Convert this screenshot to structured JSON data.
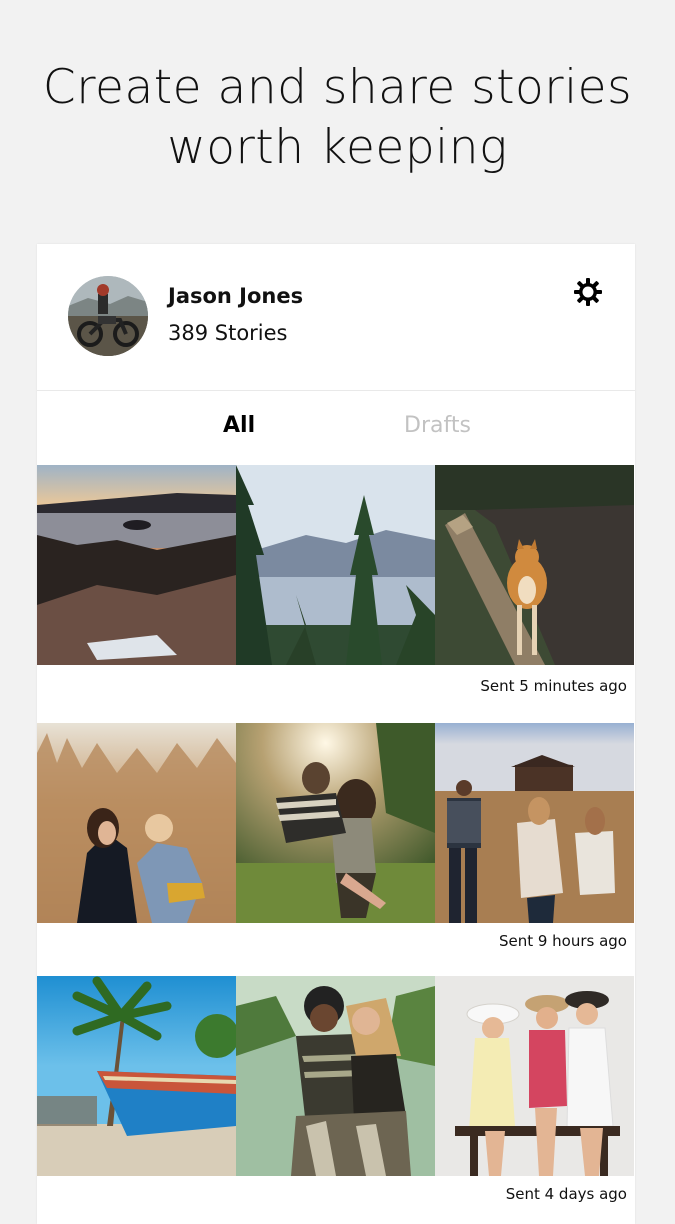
{
  "headline": {
    "line1": "Create and share stories",
    "line2": "worth keeping"
  },
  "profile": {
    "name": "Jason Jones",
    "stories": "389 Stories",
    "avatar": "avatar-motorcycle-photo",
    "settings_icon": "gear-icon"
  },
  "tabs": [
    {
      "label": "All",
      "selected": true
    },
    {
      "label": "Drafts",
      "selected": false
    }
  ],
  "stories": [
    {
      "sent": "Sent 5 minutes ago",
      "photos": [
        "lake-sunset-photo",
        "mountain-pine-lake-photo",
        "shiba-dog-on-log-photo"
      ]
    },
    {
      "sent": "Sent 9 hours ago",
      "photos": [
        "mother-child-field-photo",
        "piggyback-sunlight-photo",
        "family-walking-barn-photo"
      ]
    },
    {
      "sent": "Sent 4 days ago",
      "photos": [
        "beach-boat-palm-photo",
        "couple-hug-photo",
        "friends-hats-bench-photo"
      ]
    }
  ],
  "colors": {
    "background": "#f2f2f2",
    "card": "#ffffff",
    "text": "#111111",
    "tab_inactive": "#c2c2c2"
  }
}
